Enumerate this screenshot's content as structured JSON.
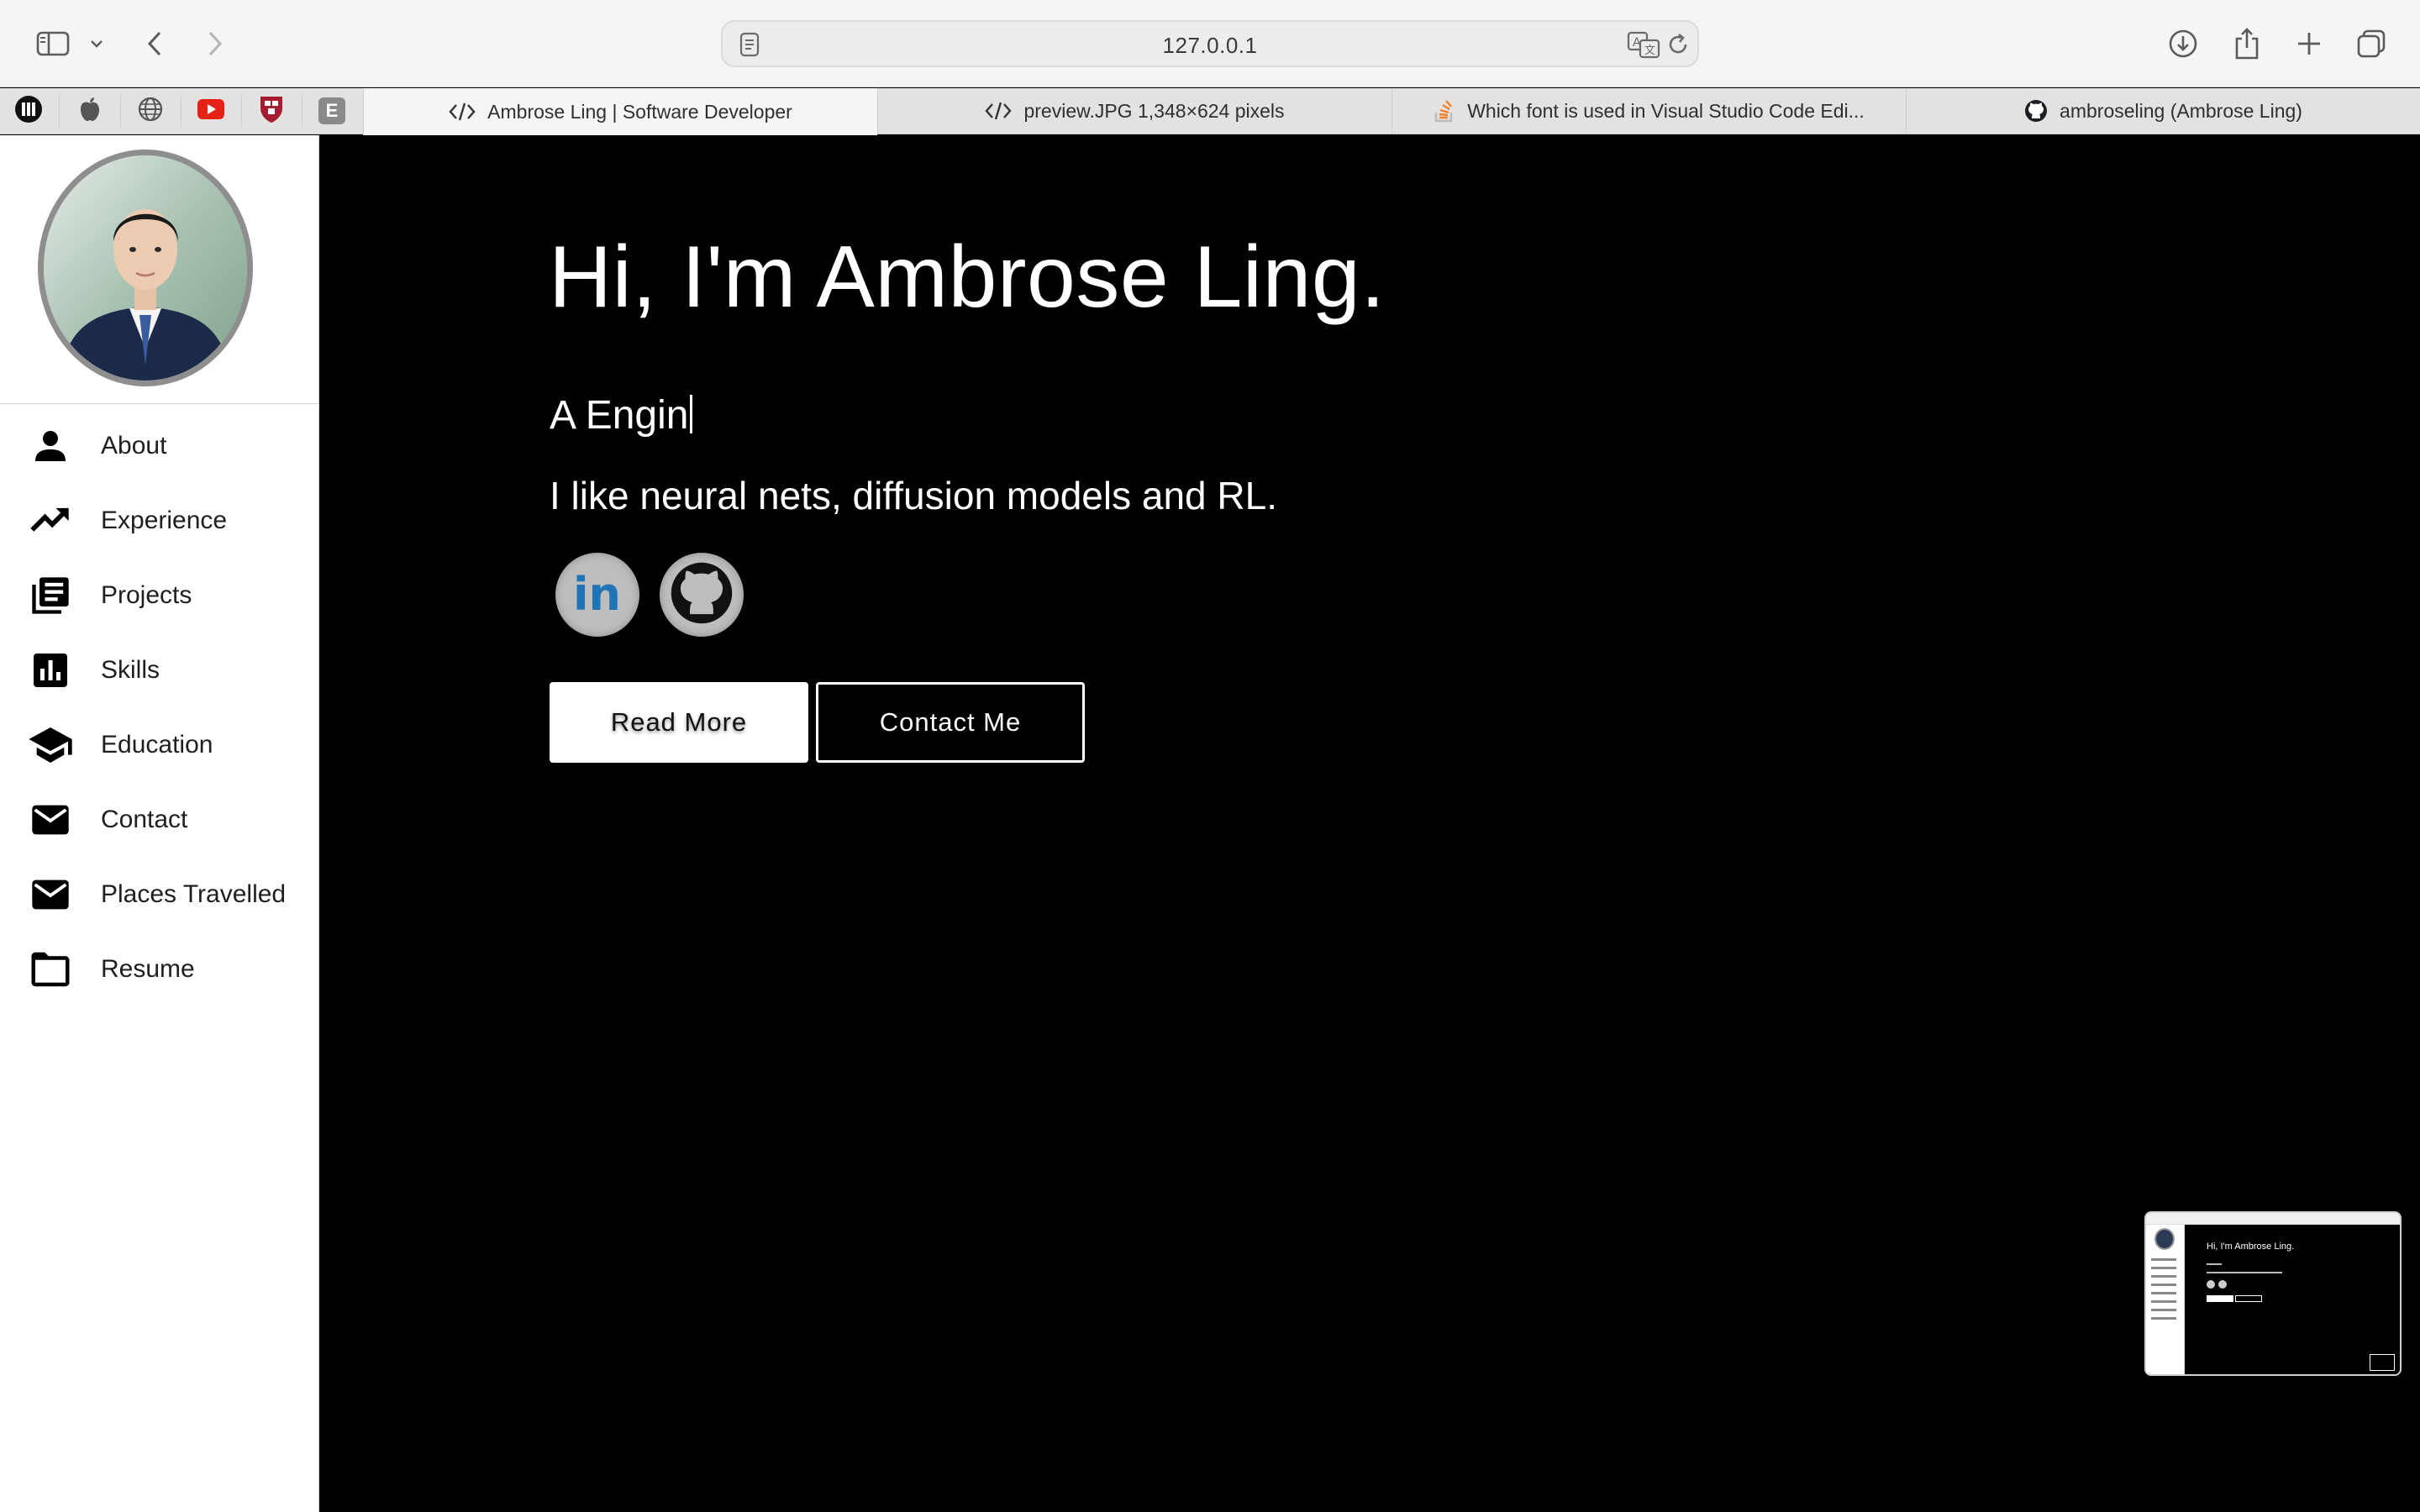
{
  "browser": {
    "url": "127.0.0.1",
    "pinned_tabs": [
      {
        "name": "pinned-tab-1",
        "icon": "bars-logo-icon"
      },
      {
        "name": "pinned-tab-apple",
        "icon": "apple-icon"
      },
      {
        "name": "pinned-tab-globe",
        "icon": "globe-icon"
      },
      {
        "name": "pinned-tab-youtube",
        "icon": "youtube-icon"
      },
      {
        "name": "pinned-tab-harvard",
        "icon": "shield-crest-icon"
      },
      {
        "name": "pinned-tab-e",
        "icon": "e-letter-icon",
        "letter": "E"
      }
    ],
    "tabs": [
      {
        "title": "Ambrose Ling | Software Developer",
        "icon": "code-icon",
        "active": true
      },
      {
        "title": "preview.JPG 1,348×624 pixels",
        "icon": "code-icon",
        "active": false
      },
      {
        "title": "Which font is used in Visual Studio Code Edi...",
        "icon": "stackoverflow-icon",
        "active": false
      },
      {
        "title": "ambroseling (Ambrose Ling)",
        "icon": "github-icon",
        "active": false
      }
    ]
  },
  "sidebar": {
    "items": [
      {
        "label": "About",
        "icon": "person-icon"
      },
      {
        "label": "Experience",
        "icon": "trending-up-icon"
      },
      {
        "label": "Projects",
        "icon": "library-books-icon"
      },
      {
        "label": "Skills",
        "icon": "bar-chart-icon"
      },
      {
        "label": "Education",
        "icon": "graduation-cap-icon"
      },
      {
        "label": "Contact",
        "icon": "mail-icon"
      },
      {
        "label": "Places Travelled",
        "icon": "mail-icon"
      },
      {
        "label": "Resume",
        "icon": "folder-icon"
      }
    ]
  },
  "hero": {
    "headline": "Hi, I'm Ambrose Ling.",
    "typed_text": "A Engin",
    "tagline": "I like neural nets, diffusion models and RL.",
    "social": [
      {
        "name": "linkedin",
        "label": "in",
        "icon": "linkedin-icon"
      },
      {
        "name": "github",
        "icon": "github-icon"
      }
    ],
    "read_more_label": "Read More",
    "contact_label": "Contact Me"
  },
  "thumbnail": {
    "title": "Hi, I'm Ambrose Ling."
  },
  "colors": {
    "background": "#000000",
    "sidebar_bg": "#ffffff",
    "chrome_bg": "#f6f5f4",
    "linkedin_blue": "#1f74b8",
    "youtube_red": "#e62117",
    "harvard_crimson": "#a51c30"
  }
}
